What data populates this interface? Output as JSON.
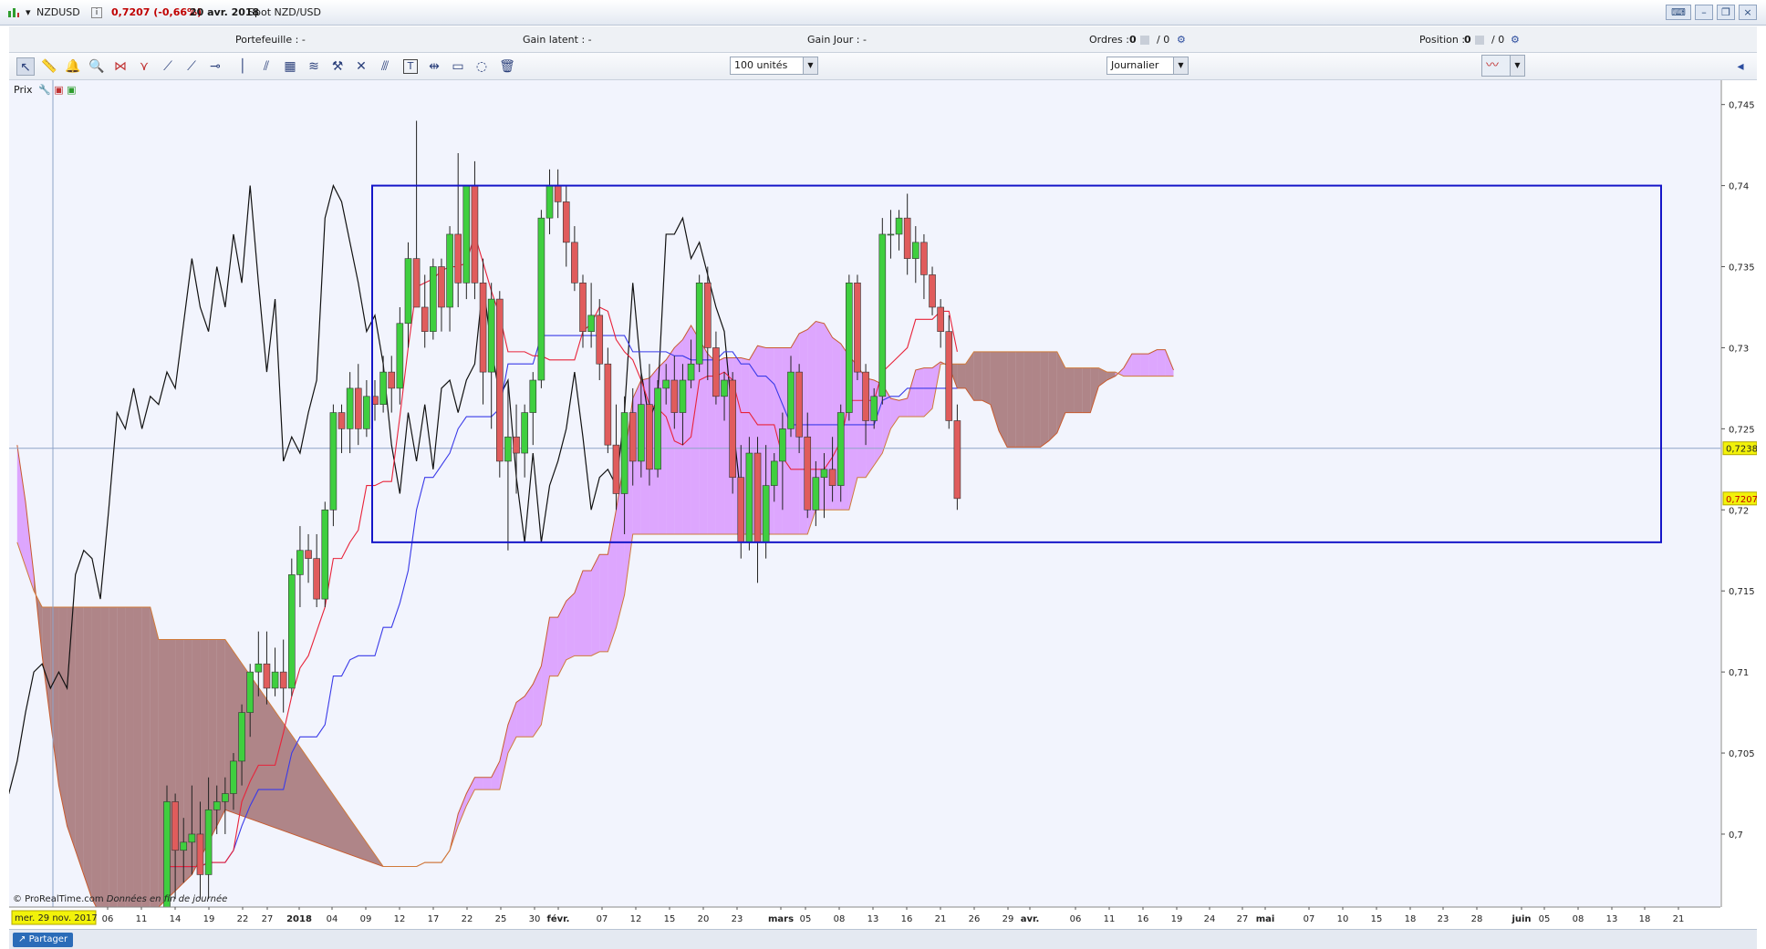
{
  "window": {
    "symbol": "NZDUSD",
    "quote": "0,7207 (-0,66%)",
    "date": "20 avr. 2018",
    "instrument": "Spot NZD/USD"
  },
  "infobar": {
    "portefeuille": "Portefeuille : -",
    "gain_latent": "Gain latent : -",
    "gain_jour": "Gain Jour : -",
    "ordres_label": "Ordres :",
    "ordres_val1": "0",
    "ordres_val2": "/ 0",
    "position_label": "Position :",
    "position_val1": "0",
    "position_val2": "/ 0"
  },
  "toolbar": {
    "units_select": "100 unités",
    "period_select": "Journalier"
  },
  "panel": {
    "label": "Prix"
  },
  "footer": {
    "copyright": "© ProRealTime.com",
    "note": "Données en fin de journée",
    "cursor_date": "mer. 29 nov. 2017",
    "share_button": "Partager"
  },
  "colors": {
    "bull_candle": "#3fcf3f",
    "bear_candle": "#e05c5c",
    "tenkan": "#e8233a",
    "kijun": "#3a3ae8",
    "chikou": "#111111",
    "kumo_bullish": "#cc66ff",
    "kumo_bearish": "#8b4a4a",
    "box": "#1515c8",
    "last_price_bg": "#f2f20a",
    "cursor_bg": "#f2f20a"
  },
  "chart_data": {
    "type": "candlestick",
    "instrument": "NZDUSD",
    "timeframe": "Journalier",
    "ylim": [
      0.6955,
      0.7465
    ],
    "y_ticks": [
      "0,745",
      "0,74",
      "0,735",
      "0,73",
      "0,725",
      "0,72",
      "0,715",
      "0,71",
      "0,705",
      "0,7"
    ],
    "y_tick_values": [
      0.745,
      0.74,
      0.735,
      0.73,
      0.725,
      0.72,
      0.715,
      0.71,
      0.705,
      0.7
    ],
    "last_price_label": "0,7207",
    "last_price": 0.7207,
    "crosshair_label": "0,7238",
    "crosshair_price": 0.7238,
    "x_ticks": [
      "06",
      "11",
      "14",
      "19",
      "22",
      "27",
      "2018",
      "04",
      "09",
      "12",
      "17",
      "22",
      "25",
      "30",
      "févr.",
      "07",
      "12",
      "15",
      "20",
      "23",
      "mars",
      "05",
      "08",
      "13",
      "16",
      "21",
      "26",
      "29",
      "avr.",
      "06",
      "11",
      "16",
      "19",
      "24",
      "27",
      "mai",
      "07",
      "10",
      "15",
      "18",
      "23",
      "28",
      "juin",
      "05",
      "08",
      "13",
      "18",
      "21"
    ],
    "candles": [
      [
        "2017-12-13",
        0.693,
        0.703,
        0.693,
        0.702
      ],
      [
        "2017-12-14",
        0.702,
        0.7025,
        0.696,
        0.699
      ],
      [
        "2017-12-15",
        0.699,
        0.701,
        0.697,
        0.6995
      ],
      [
        "2017-12-18",
        0.6995,
        0.703,
        0.6975,
        0.7
      ],
      [
        "2017-12-19",
        0.7,
        0.702,
        0.696,
        0.6975
      ],
      [
        "2017-12-20",
        0.6975,
        0.7035,
        0.696,
        0.7015
      ],
      [
        "2017-12-21",
        0.7015,
        0.703,
        0.7,
        0.702
      ],
      [
        "2017-12-22",
        0.702,
        0.7035,
        0.7,
        0.7025
      ],
      [
        "2017-12-26",
        0.7025,
        0.705,
        0.7015,
        0.7045
      ],
      [
        "2017-12-27",
        0.7045,
        0.708,
        0.703,
        0.7075
      ],
      [
        "2017-12-28",
        0.7075,
        0.7105,
        0.706,
        0.71
      ],
      [
        "2017-12-29",
        0.71,
        0.7125,
        0.7085,
        0.7105
      ],
      [
        "2018-01-02",
        0.7105,
        0.7125,
        0.708,
        0.709
      ],
      [
        "2018-01-03",
        0.709,
        0.7115,
        0.7085,
        0.71
      ],
      [
        "2018-01-04",
        0.71,
        0.712,
        0.7075,
        0.709
      ],
      [
        "2018-01-05",
        0.709,
        0.717,
        0.7085,
        0.716
      ],
      [
        "2018-01-08",
        0.716,
        0.719,
        0.714,
        0.7175
      ],
      [
        "2018-01-09",
        0.7175,
        0.7185,
        0.7155,
        0.717
      ],
      [
        "2018-01-10",
        0.717,
        0.7185,
        0.714,
        0.7145
      ],
      [
        "2018-01-11",
        0.7145,
        0.7205,
        0.714,
        0.72
      ],
      [
        "2018-01-12",
        0.72,
        0.7265,
        0.719,
        0.726
      ],
      [
        "2018-01-15",
        0.726,
        0.7265,
        0.7235,
        0.725
      ],
      [
        "2018-01-16",
        0.725,
        0.7285,
        0.7235,
        0.7275
      ],
      [
        "2018-01-17",
        0.7275,
        0.729,
        0.724,
        0.725
      ],
      [
        "2018-01-18",
        0.725,
        0.728,
        0.7245,
        0.727
      ],
      [
        "2018-01-19",
        0.727,
        0.728,
        0.7255,
        0.7265
      ],
      [
        "2018-01-22",
        0.7265,
        0.7295,
        0.726,
        0.7285
      ],
      [
        "2018-01-23",
        0.7285,
        0.7295,
        0.726,
        0.7275
      ],
      [
        "2018-01-24",
        0.7275,
        0.7325,
        0.7265,
        0.7315
      ],
      [
        "2018-01-25",
        0.7315,
        0.7365,
        0.73,
        0.7355
      ],
      [
        "2018-01-26",
        0.7355,
        0.744,
        0.734,
        0.7325
      ],
      [
        "2018-01-29",
        0.7325,
        0.7345,
        0.73,
        0.731
      ],
      [
        "2018-01-30",
        0.731,
        0.7355,
        0.7305,
        0.735
      ],
      [
        "2018-01-31",
        0.735,
        0.7355,
        0.731,
        0.7325
      ],
      [
        "2018-02-01",
        0.7325,
        0.7375,
        0.731,
        0.737
      ],
      [
        "2018-02-02",
        0.737,
        0.742,
        0.7325,
        0.734
      ],
      [
        "2018-02-05",
        0.734,
        0.74,
        0.733,
        0.74
      ],
      [
        "2018-02-06",
        0.74,
        0.7415,
        0.733,
        0.734
      ],
      [
        "2018-02-07",
        0.734,
        0.7355,
        0.7265,
        0.7285
      ],
      [
        "2018-02-08",
        0.7285,
        0.734,
        0.725,
        0.733
      ],
      [
        "2018-02-09",
        0.733,
        0.7335,
        0.722,
        0.723
      ],
      [
        "2018-02-12",
        0.723,
        0.728,
        0.7175,
        0.7245
      ],
      [
        "2018-02-13",
        0.7245,
        0.7265,
        0.721,
        0.7235
      ],
      [
        "2018-02-14",
        0.7235,
        0.7265,
        0.722,
        0.726
      ],
      [
        "2018-02-15",
        0.726,
        0.7285,
        0.724,
        0.728
      ],
      [
        "2018-02-16",
        0.728,
        0.7385,
        0.7275,
        0.738
      ],
      [
        "2018-02-19",
        0.738,
        0.741,
        0.737,
        0.74
      ],
      [
        "2018-02-20",
        0.74,
        0.741,
        0.738,
        0.739
      ],
      [
        "2018-02-21",
        0.739,
        0.74,
        0.735,
        0.7365
      ],
      [
        "2018-02-22",
        0.7365,
        0.7375,
        0.7335,
        0.734
      ],
      [
        "2018-02-23",
        0.734,
        0.7345,
        0.73,
        0.731
      ],
      [
        "2018-02-26",
        0.731,
        0.734,
        0.73,
        0.732
      ],
      [
        "2018-02-27",
        0.732,
        0.733,
        0.728,
        0.729
      ],
      [
        "2018-02-28",
        0.729,
        0.73,
        0.7235,
        0.724
      ],
      [
        "2018-03-01",
        0.724,
        0.7265,
        0.72,
        0.721
      ],
      [
        "2018-03-02",
        0.721,
        0.727,
        0.7185,
        0.726
      ],
      [
        "2018-03-05",
        0.726,
        0.7275,
        0.7215,
        0.723
      ],
      [
        "2018-03-06",
        0.723,
        0.7285,
        0.722,
        0.7265
      ],
      [
        "2018-03-07",
        0.7265,
        0.729,
        0.7215,
        0.7225
      ],
      [
        "2018-03-08",
        0.7225,
        0.728,
        0.722,
        0.7275
      ],
      [
        "2018-03-09",
        0.7275,
        0.729,
        0.7265,
        0.728
      ],
      [
        "2018-03-12",
        0.728,
        0.7295,
        0.725,
        0.726
      ],
      [
        "2018-03-13",
        0.726,
        0.729,
        0.724,
        0.728
      ],
      [
        "2018-03-14",
        0.728,
        0.7305,
        0.7275,
        0.729
      ],
      [
        "2018-03-15",
        0.729,
        0.7345,
        0.7285,
        0.734
      ],
      [
        "2018-03-16",
        0.734,
        0.735,
        0.728,
        0.73
      ],
      [
        "2018-03-19",
        0.73,
        0.731,
        0.7265,
        0.727
      ],
      [
        "2018-03-20",
        0.727,
        0.7285,
        0.7255,
        0.728
      ],
      [
        "2018-03-21",
        0.728,
        0.7285,
        0.721,
        0.722
      ],
      [
        "2018-03-22",
        0.722,
        0.724,
        0.717,
        0.718
      ],
      [
        "2018-03-23",
        0.718,
        0.7245,
        0.7175,
        0.7235
      ],
      [
        "2018-03-26",
        0.7235,
        0.7245,
        0.7155,
        0.718
      ],
      [
        "2018-03-27",
        0.718,
        0.724,
        0.717,
        0.7215
      ],
      [
        "2018-03-28",
        0.7215,
        0.7235,
        0.7205,
        0.723
      ],
      [
        "2018-03-29",
        0.723,
        0.726,
        0.72,
        0.725
      ],
      [
        "2018-03-30",
        0.725,
        0.7295,
        0.7245,
        0.7285
      ],
      [
        "2018-04-02",
        0.7285,
        0.729,
        0.7235,
        0.7245
      ],
      [
        "2018-04-03",
        0.7245,
        0.726,
        0.7195,
        0.72
      ],
      [
        "2018-04-04",
        0.72,
        0.723,
        0.719,
        0.722
      ],
      [
        "2018-04-05",
        0.722,
        0.7235,
        0.7195,
        0.7225
      ],
      [
        "2018-04-06",
        0.7225,
        0.7245,
        0.7205,
        0.7215
      ],
      [
        "2018-04-09",
        0.7215,
        0.7265,
        0.7205,
        0.726
      ],
      [
        "2018-04-10",
        0.726,
        0.7345,
        0.7255,
        0.734
      ],
      [
        "2018-04-11",
        0.734,
        0.7345,
        0.728,
        0.7285
      ],
      [
        "2018-04-12",
        0.7285,
        0.729,
        0.724,
        0.7255
      ],
      [
        "2018-04-13",
        0.7255,
        0.7275,
        0.725,
        0.727
      ],
      [
        "2018-04-16",
        0.727,
        0.738,
        0.7265,
        0.737
      ],
      [
        "2018-04-17",
        0.737,
        0.7385,
        0.7355,
        0.737
      ],
      [
        "2018-04-18",
        0.737,
        0.7385,
        0.736,
        0.738
      ],
      [
        "2018-04-19",
        0.738,
        0.7395,
        0.7345,
        0.7355
      ],
      [
        "2018-04-20",
        0.7355,
        0.7375,
        0.734,
        0.7365
      ],
      [
        "2018-04-23",
        0.7365,
        0.737,
        0.733,
        0.7345
      ],
      [
        "2018-04-24",
        0.7345,
        0.735,
        0.732,
        0.7325
      ],
      [
        "2018-04-25",
        0.7325,
        0.733,
        0.73,
        0.731
      ],
      [
        "2018-04-26",
        0.731,
        0.732,
        0.725,
        0.7255
      ],
      [
        "2018-04-27",
        0.7255,
        0.7265,
        0.72,
        0.7207
      ]
    ],
    "rectangle": {
      "price_top": 0.74,
      "price_bottom": 0.718,
      "date_start": "2018-01-19",
      "date_end": "2018-06-18"
    },
    "indicators": [
      "Ichimoku tenkan",
      "Ichimoku kijun",
      "Ichimoku chikou",
      "Kumo"
    ]
  }
}
